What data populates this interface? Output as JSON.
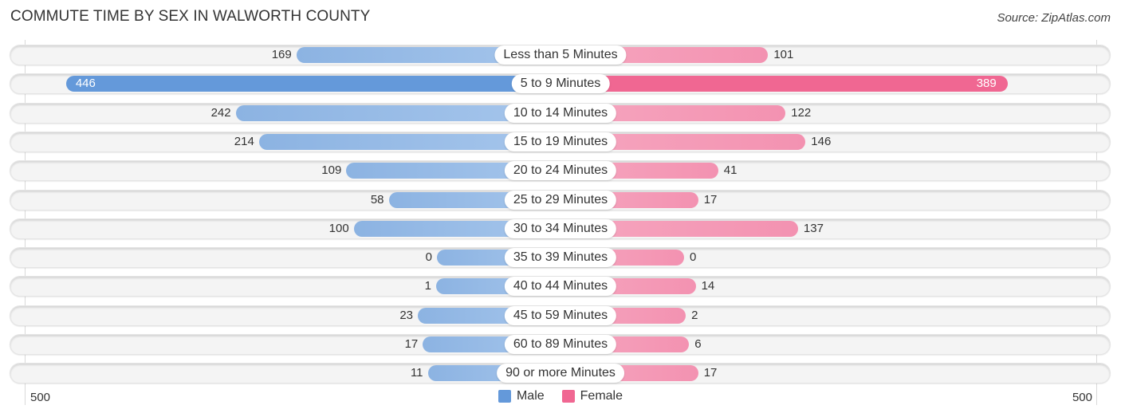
{
  "chart_data": {
    "type": "bar",
    "orientation": "horizontal-diverging",
    "title": "COMMUTE TIME BY SEX IN WALWORTH COUNTY",
    "source": "Source: ZipAtlas.com",
    "categories": [
      "Less than 5 Minutes",
      "5 to 9 Minutes",
      "10 to 14 Minutes",
      "15 to 19 Minutes",
      "20 to 24 Minutes",
      "25 to 29 Minutes",
      "30 to 34 Minutes",
      "35 to 39 Minutes",
      "40 to 44 Minutes",
      "45 to 59 Minutes",
      "60 to 89 Minutes",
      "90 or more Minutes"
    ],
    "series": [
      {
        "name": "Male",
        "color": "#6499da",
        "values": [
          169,
          446,
          242,
          214,
          109,
          58,
          100,
          0,
          1,
          23,
          17,
          11
        ]
      },
      {
        "name": "Female",
        "color": "#f06792",
        "values": [
          101,
          389,
          122,
          146,
          41,
          17,
          137,
          0,
          14,
          2,
          6,
          17
        ]
      }
    ],
    "axis": {
      "left_label": "500",
      "right_label": "500",
      "range": [
        -500,
        500
      ]
    },
    "legend": {
      "position": "bottom-center",
      "items": [
        "Male",
        "Female"
      ]
    },
    "grid": false
  }
}
